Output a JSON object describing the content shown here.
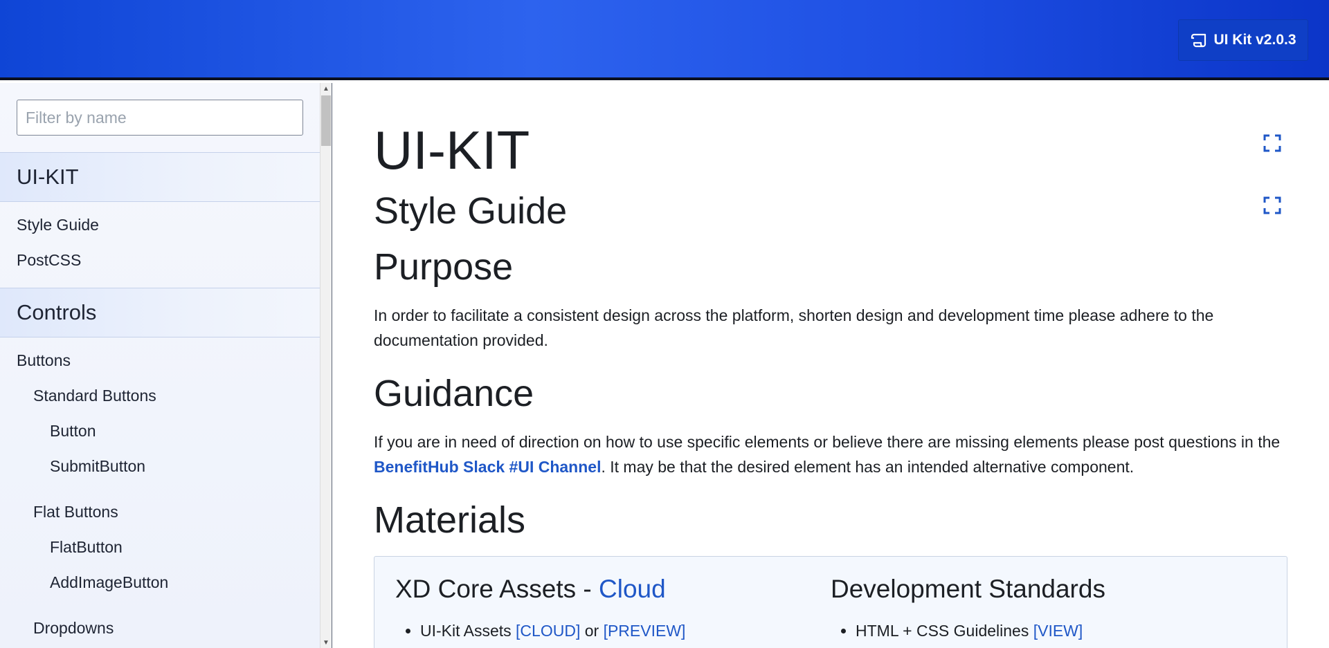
{
  "header": {
    "version_label": "UI Kit v2.0.3"
  },
  "sidebar": {
    "filter_placeholder": "Filter by name",
    "sections": [
      {
        "title": "UI-KIT",
        "items": [
          {
            "label": "Style Guide",
            "level": 0
          },
          {
            "label": "PostCSS",
            "level": 0
          }
        ]
      },
      {
        "title": "Controls",
        "items": [
          {
            "label": "Buttons",
            "level": 0
          },
          {
            "label": "Standard Buttons",
            "level": 1
          },
          {
            "label": "Button",
            "level": 2
          },
          {
            "label": "SubmitButton",
            "level": 2
          },
          {
            "label": "Flat Buttons",
            "level": 1
          },
          {
            "label": "FlatButton",
            "level": 2
          },
          {
            "label": "AddImageButton",
            "level": 2
          },
          {
            "label": "Dropdowns",
            "level": 1
          }
        ]
      }
    ]
  },
  "main": {
    "title": "UI-KIT",
    "subtitle": "Style Guide",
    "purpose_heading": "Purpose",
    "purpose_text": "In order to facilitate a consistent design across the platform, shorten design and development time please adhere to the documentation provided.",
    "guidance_heading": "Guidance",
    "guidance_text_before": "If you are in need of direction on how to use specific elements or believe there are missing elements please post questions in the ",
    "guidance_link": "BenefitHub Slack #UI Channel",
    "guidance_text_after": ". It may be that the desired element has an intended alternative component.",
    "materials_heading": "Materials",
    "materials": {
      "left_title": "XD Core Assets - ",
      "left_title_link": "Cloud",
      "left_item_label": "UI-Kit Assets ",
      "left_item_link1": "[CLOUD]",
      "left_item_or": " or ",
      "left_item_link2": "[PREVIEW]",
      "right_title": "Development Standards",
      "right_item_label": "HTML + CSS Guidelines ",
      "right_item_link": "[VIEW]"
    }
  },
  "icons": {
    "version": "scroll-icon",
    "expand": "expand-icon"
  }
}
